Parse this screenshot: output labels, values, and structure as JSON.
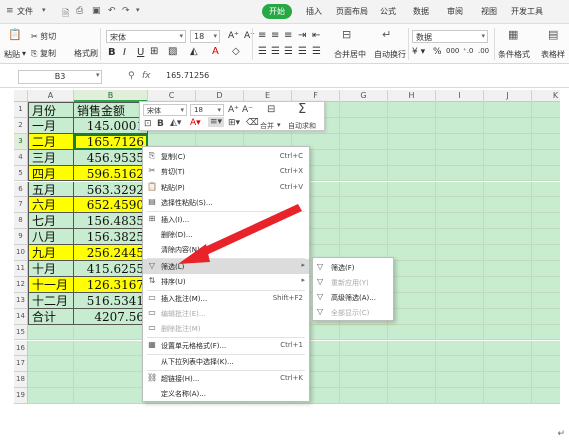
{
  "ribbon": {
    "file_menu": "文件",
    "tabs": [
      "开始",
      "插入",
      "页面布局",
      "公式",
      "数据",
      "审阅",
      "视图",
      "开发工具"
    ],
    "active_tab": "开始"
  },
  "toolbar": {
    "paste": "粘贴",
    "cut": "剪切",
    "copy": "复制",
    "format_painter": "格式刷",
    "font_name": "宋体",
    "font_size": "18",
    "merge_center": "合并居中",
    "wrap_text": "自动换行",
    "number_format": "数据",
    "conditional_format": "条件格式",
    "table_style": "表格样"
  },
  "formula_bar": {
    "name_box": "B3",
    "fx_label": "fx",
    "value": "165.71256"
  },
  "grid": {
    "columns": [
      "A",
      "B",
      "C",
      "D",
      "E",
      "F",
      "G",
      "H",
      "I",
      "J",
      "K"
    ],
    "rows": [
      "1",
      "2",
      "3",
      "4",
      "5",
      "6",
      "7",
      "8",
      "9",
      "10",
      "11",
      "12",
      "13",
      "14",
      "15",
      "16",
      "17",
      "18",
      "19"
    ],
    "header": {
      "a": "月份",
      "b": "销售金额"
    },
    "data": [
      {
        "a": "一月",
        "b": "145.0001",
        "yellow": false
      },
      {
        "a": "二月",
        "b": "165.7126",
        "yellow": true
      },
      {
        "a": "三月",
        "b": "456.9535",
        "yellow": false
      },
      {
        "a": "四月",
        "b": "596.5162",
        "yellow": true
      },
      {
        "a": "五月",
        "b": "563.3292",
        "yellow": false
      },
      {
        "a": "六月",
        "b": "652.4590",
        "yellow": true
      },
      {
        "a": "七月",
        "b": "156.4835",
        "yellow": false
      },
      {
        "a": "八月",
        "b": "156.3825",
        "yellow": false
      },
      {
        "a": "九月",
        "b": "256.2445",
        "yellow": true
      },
      {
        "a": "十月",
        "b": "415.6255",
        "yellow": false
      },
      {
        "a": "十一月",
        "b": "126.3167",
        "yellow": true
      },
      {
        "a": "十二月",
        "b": "516.5341",
        "yellow": false
      },
      {
        "a": "合计",
        "b": "4207.56",
        "yellow": false
      }
    ]
  },
  "mini_toolbar": {
    "font_name": "宋体",
    "font_size": "18",
    "merge": "合并",
    "autosum": "自动求和"
  },
  "context_menu": {
    "items": [
      {
        "icon": "copy-icon",
        "glyph": "⎘",
        "label": "复制(C)",
        "shortcut": "Ctrl+C"
      },
      {
        "icon": "cut-icon",
        "glyph": "✂",
        "label": "剪切(T)",
        "shortcut": "Ctrl+X"
      },
      {
        "icon": "paste-icon",
        "glyph": "📋",
        "label": "粘贴(P)",
        "shortcut": "Ctrl+V"
      },
      {
        "icon": "paste-special-icon",
        "glyph": "▤",
        "label": "选择性粘贴(S)...",
        "shortcut": ""
      },
      {
        "icon": "insert-icon",
        "glyph": "⊞",
        "label": "插入(I)...",
        "shortcut": ""
      },
      {
        "icon": "",
        "glyph": "",
        "label": "删除(D)...",
        "shortcut": ""
      },
      {
        "icon": "",
        "glyph": "",
        "label": "清除内容(N)",
        "shortcut": ""
      },
      {
        "icon": "filter-icon",
        "glyph": "▽",
        "label": "筛选(L)",
        "shortcut": ""
      },
      {
        "icon": "sort-icon",
        "glyph": "⇅",
        "label": "排序(U)",
        "shortcut": ""
      },
      {
        "icon": "comment-icon",
        "glyph": "▭",
        "label": "插入批注(M)...",
        "shortcut": "Shift+F2"
      },
      {
        "icon": "edit-comment-icon",
        "glyph": "▭",
        "label": "编辑批注(E)...",
        "shortcut": ""
      },
      {
        "icon": "delete-comment-icon",
        "glyph": "▭",
        "label": "删除批注(M)",
        "shortcut": ""
      },
      {
        "icon": "format-cells-icon",
        "glyph": "▦",
        "label": "设置单元格格式(F)...",
        "shortcut": "Ctrl+1"
      },
      {
        "icon": "",
        "glyph": "",
        "label": "从下拉列表中选择(K)...",
        "shortcut": ""
      },
      {
        "icon": "hyperlink-icon",
        "glyph": "⛓",
        "label": "超链接(H)...",
        "shortcut": "Ctrl+K"
      },
      {
        "icon": "",
        "glyph": "",
        "label": "定义名称(A)...",
        "shortcut": ""
      }
    ]
  },
  "filter_submenu": {
    "items": [
      {
        "glyph": "▽",
        "label": "筛选(F)",
        "disabled": false
      },
      {
        "glyph": "▽",
        "label": "重新应用(Y)",
        "disabled": true
      },
      {
        "glyph": "▽",
        "label": "高级筛选(A)...",
        "disabled": false
      },
      {
        "glyph": "▽",
        "label": "全部显示(C)",
        "disabled": true
      }
    ]
  },
  "colors": {
    "accent": "#27a844",
    "sheet_bg": "#c7eccf",
    "highlight": "#ffff00",
    "arrow": "#e8232a"
  }
}
